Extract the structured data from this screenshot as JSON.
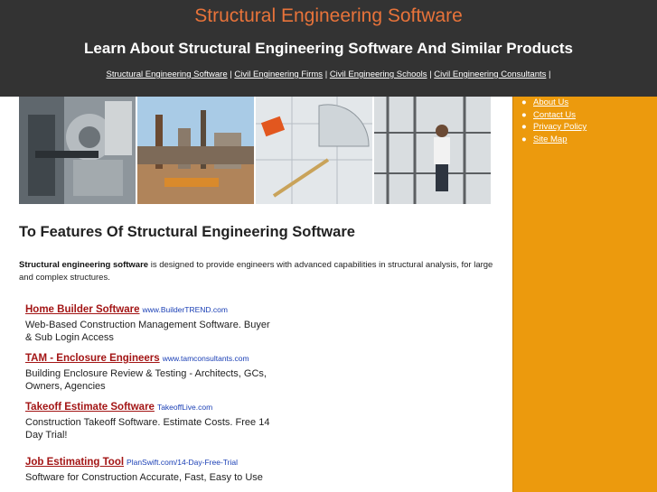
{
  "header": {
    "title": "Structural Engineering Software",
    "subtitle": "Learn About Structural Engineering Software And Similar Products",
    "nav": [
      {
        "label": "Structural Engineering Software"
      },
      {
        "label": "Civil Engineering Firms"
      },
      {
        "label": "Civil Engineering Schools"
      },
      {
        "label": "Civil Engineering Consultants"
      }
    ],
    "separator": "|"
  },
  "sidebar": {
    "bullet": "●",
    "items": [
      {
        "label": "About Us"
      },
      {
        "label": "Contact Us"
      },
      {
        "label": "Privacy Policy"
      },
      {
        "label": "Site Map"
      }
    ]
  },
  "main": {
    "headline": "To Features Of Structural Engineering Software",
    "intro_bold": "Structural engineering software",
    "intro_text": " is designed to provide engineers with advanced capabilities in structural analysis, for large and complex structures.",
    "ads": [
      {
        "title": "Home Builder Software",
        "url": "www.BuilderTREND.com",
        "desc": "Web-Based Construction Management Software. Buyer & Sub Login Access"
      },
      {
        "title": "TAM - Enclosure Engineers",
        "url": "www.tamconsultants.com",
        "desc": "Building Enclosure Review & Testing - Architects, GCs, Owners, Agencies"
      },
      {
        "title": "Takeoff Estimate Software",
        "url": "TakeoffLive.com",
        "desc": "Construction Takeoff Software. Estimate Costs. Free 14 Day Trial!"
      },
      {
        "title": "Job Estimating Tool",
        "url": "PlanSwift.com/14-Day-Free-Trial",
        "desc": "Software for Construction Accurate, Fast, Easy to Use"
      }
    ]
  },
  "colors": {
    "header_bg": "#333333",
    "title": "#e8733a",
    "sidebar_bg": "#ec9a0d",
    "ad_title": "#a31515",
    "ad_url": "#1a3fb5"
  }
}
